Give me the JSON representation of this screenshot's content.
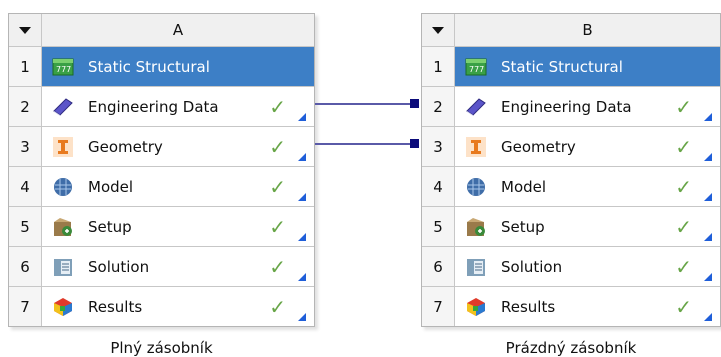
{
  "systems": [
    {
      "column_letter": "A",
      "caption": "Plný zásobník",
      "rows": [
        {
          "num": "1",
          "label": "Static Structural",
          "icon": "static-structural-icon",
          "status": ""
        },
        {
          "num": "2",
          "label": "Engineering Data",
          "icon": "engineering-data-icon",
          "status": "✓"
        },
        {
          "num": "3",
          "label": "Geometry",
          "icon": "geometry-icon",
          "status": "✓"
        },
        {
          "num": "4",
          "label": "Model",
          "icon": "model-icon",
          "status": "✓"
        },
        {
          "num": "5",
          "label": "Setup",
          "icon": "setup-icon",
          "status": "✓"
        },
        {
          "num": "6",
          "label": "Solution",
          "icon": "solution-icon",
          "status": "✓"
        },
        {
          "num": "7",
          "label": "Results",
          "icon": "results-icon",
          "status": "✓"
        }
      ]
    },
    {
      "column_letter": "B",
      "caption": "Prázdný zásobník",
      "rows": [
        {
          "num": "1",
          "label": "Static Structural",
          "icon": "static-structural-icon",
          "status": ""
        },
        {
          "num": "2",
          "label": "Engineering Data",
          "icon": "engineering-data-icon",
          "status": "✓"
        },
        {
          "num": "3",
          "label": "Geometry",
          "icon": "geometry-icon",
          "status": "✓"
        },
        {
          "num": "4",
          "label": "Model",
          "icon": "model-icon",
          "status": "✓"
        },
        {
          "num": "5",
          "label": "Setup",
          "icon": "setup-icon",
          "status": "✓"
        },
        {
          "num": "6",
          "label": "Solution",
          "icon": "solution-icon",
          "status": "✓"
        },
        {
          "num": "7",
          "label": "Results",
          "icon": "results-icon",
          "status": "✓"
        }
      ]
    }
  ],
  "colors": {
    "title_bar": "#3d7fc6",
    "check": "#67a547",
    "connector": "#5a5aa8",
    "port": "#0b0b7a"
  }
}
